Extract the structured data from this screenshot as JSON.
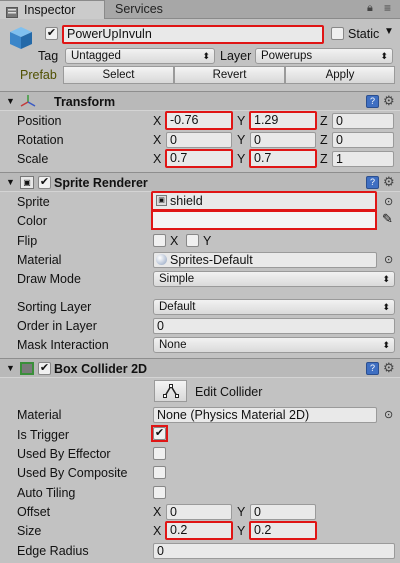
{
  "tabs": {
    "inspector": "Inspector",
    "services": "Services"
  },
  "object": {
    "name": "PowerUpInvuln",
    "static_label": "Static",
    "tag_label": "Tag",
    "tag_value": "Untagged",
    "layer_label": "Layer",
    "layer_value": "Powerups",
    "prefab_label": "Prefab",
    "prefab_select": "Select",
    "prefab_revert": "Revert",
    "prefab_apply": "Apply"
  },
  "transform": {
    "title": "Transform",
    "position_label": "Position",
    "rotation_label": "Rotation",
    "scale_label": "Scale",
    "axis_x": "X",
    "axis_y": "Y",
    "axis_z": "Z",
    "position": {
      "x": "-0.76",
      "y": "1.29",
      "z": "0"
    },
    "rotation": {
      "x": "0",
      "y": "0",
      "z": "0"
    },
    "scale": {
      "x": "0.7",
      "y": "0.7",
      "z": "1"
    }
  },
  "sprite_renderer": {
    "title": "Sprite Renderer",
    "sprite_label": "Sprite",
    "sprite_value": "shield",
    "color_label": "Color",
    "flip_label": "Flip",
    "flip_x": "X",
    "flip_y": "Y",
    "material_label": "Material",
    "material_value": "Sprites-Default",
    "draw_mode_label": "Draw Mode",
    "draw_mode_value": "Simple",
    "sorting_layer_label": "Sorting Layer",
    "sorting_layer_value": "Default",
    "order_label": "Order in Layer",
    "order_value": "0",
    "mask_label": "Mask Interaction",
    "mask_value": "None"
  },
  "box_collider": {
    "title": "Box Collider 2D",
    "edit_collider": "Edit Collider",
    "material_label": "Material",
    "material_value": "None (Physics Material 2D)",
    "is_trigger_label": "Is Trigger",
    "effector_label": "Used By Effector",
    "composite_label": "Used By Composite",
    "auto_tiling_label": "Auto Tiling",
    "offset_label": "Offset",
    "offset": {
      "x": "0",
      "y": "0"
    },
    "size_label": "Size",
    "size": {
      "x": "0.2",
      "y": "0.2"
    },
    "edge_radius_label": "Edge Radius",
    "edge_radius_value": "0"
  },
  "colors": {
    "highlight": "#e01515",
    "background": "#c2c2c2"
  }
}
